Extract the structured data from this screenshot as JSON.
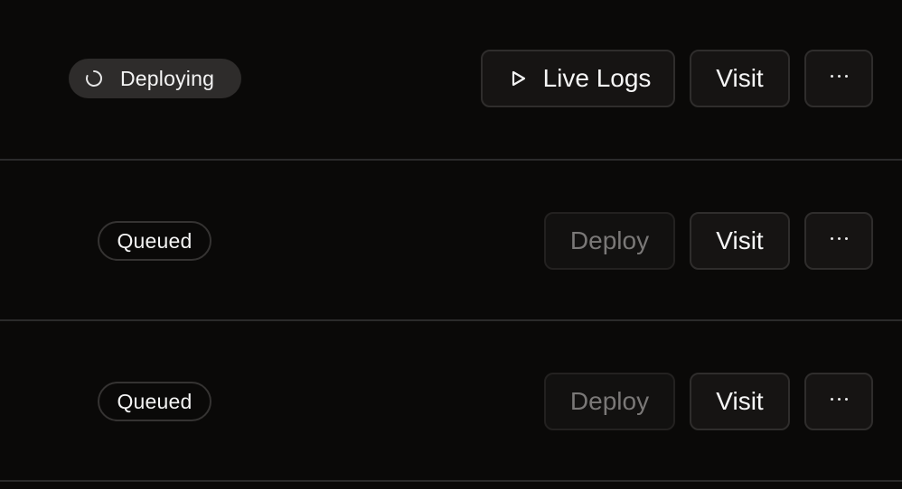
{
  "deployments": [
    {
      "status": "Deploying",
      "primary_action": "Live Logs",
      "visit_label": "Visit"
    },
    {
      "status": "Queued",
      "primary_action": "Deploy",
      "visit_label": "Visit"
    },
    {
      "status": "Queued",
      "primary_action": "Deploy",
      "visit_label": "Visit"
    }
  ],
  "icons": {
    "spinner": "spinner-icon",
    "play": "play-icon",
    "more": "more-horizontal-icon"
  },
  "colors": {
    "background": "#0a0908",
    "divider": "#2b2b2b",
    "badge_deploying_bg": "#2e2c2b",
    "button_bg": "#161413",
    "button_border": "#2f2d2c",
    "disabled_text": "#7a7877"
  }
}
